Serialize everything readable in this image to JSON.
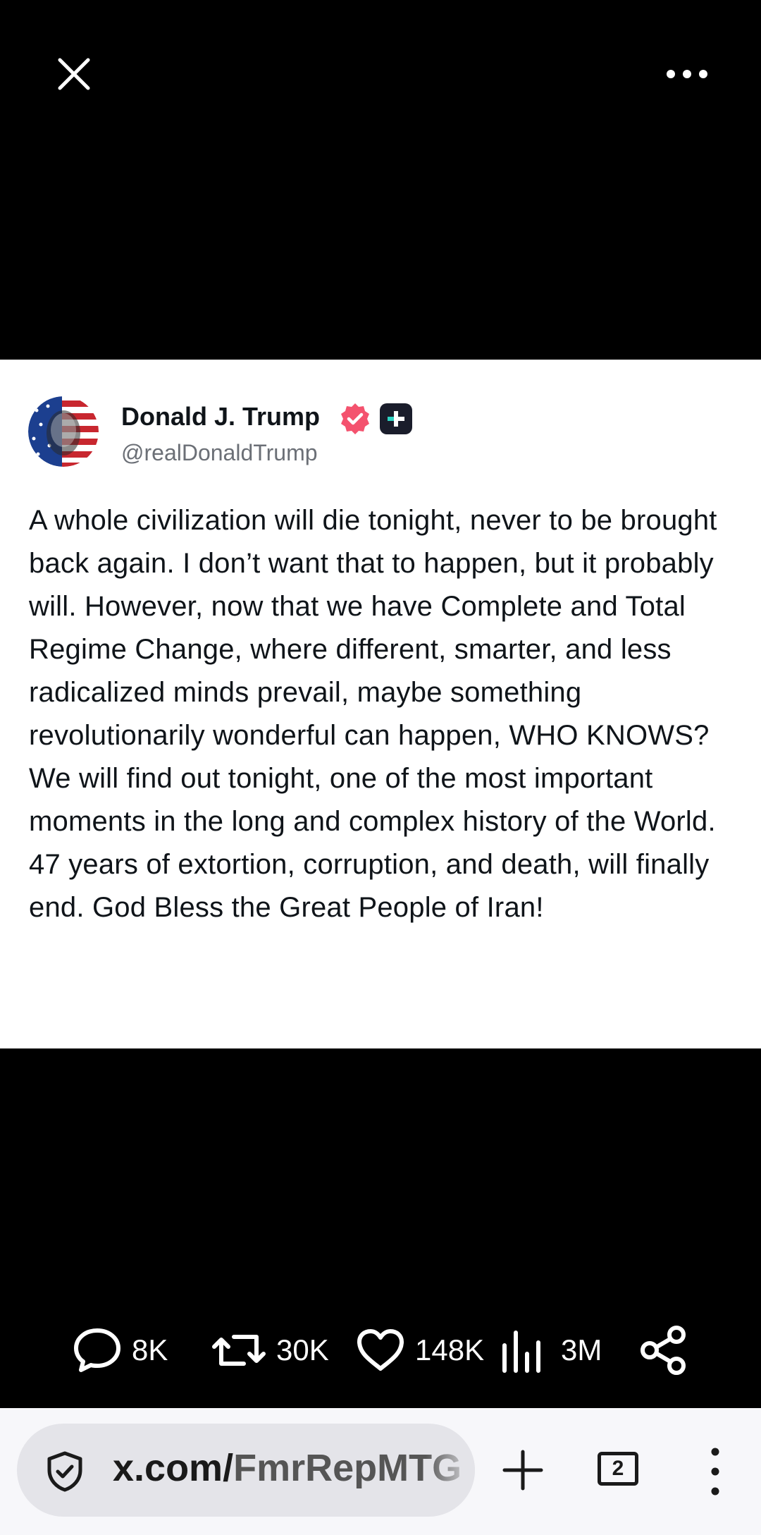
{
  "post": {
    "author_name": "Donald J. Trump",
    "author_handle": "@realDonaldTrump",
    "text": "A whole civilization will die tonight, never to be brought back again. I don’t want that to happen, but it probably will. However, now that we have Complete and Total Regime Change, where different, smarter, and less radicalized minds prevail, maybe something revolutionarily wonderful can happen, WHO KNOWS? We will find out tonight, one of the most important moments in the long and complex history of the World. 47 years of extortion, corruption, and death, will finally end. God Bless the Great People of Iran!",
    "verified_badge_color": "#f4526e"
  },
  "actions": {
    "replies": "8K",
    "reposts": "30K",
    "likes": "148K",
    "views": "3M"
  },
  "browser": {
    "url_domain": "x.com/",
    "url_path": "FmrRepMTG",
    "tab_count": "2"
  },
  "icons": {
    "close": "close-icon",
    "more": "more-horizontal-icon",
    "reply": "reply-icon",
    "repost": "repost-icon",
    "like": "heart-icon",
    "views": "views-chart-icon",
    "share": "share-icon",
    "shield": "shield-icon",
    "new_tab": "plus-icon",
    "menu": "more-vertical-icon"
  }
}
